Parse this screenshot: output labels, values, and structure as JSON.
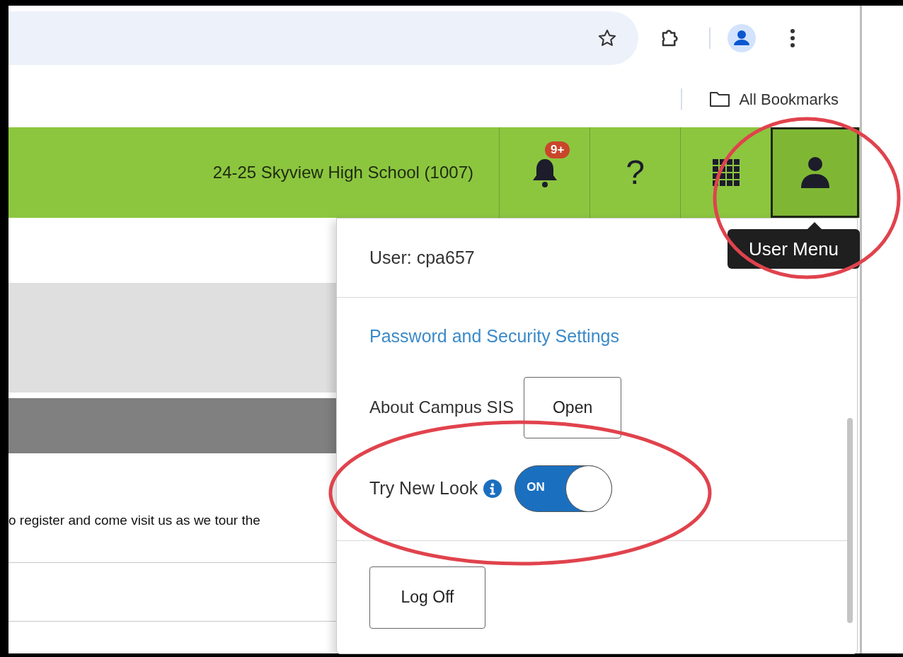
{
  "browser": {
    "bookmarks_bar": {
      "items": [
        {
          "label": "All Bookmarks"
        }
      ]
    }
  },
  "header": {
    "school": "24-25 Skyview High School (1007)",
    "buttons": [
      {
        "kind": "notifications",
        "badge": "9+",
        "selected": false
      },
      {
        "kind": "help",
        "label": "?",
        "selected": false
      },
      {
        "kind": "apps",
        "selected": false
      },
      {
        "kind": "user",
        "selected": true
      }
    ]
  },
  "tooltip": "User Menu",
  "page": {
    "notice_fragment": "o register and come visit us as we tour the"
  },
  "user_menu": {
    "user": "User: cpa657",
    "security_link": "Password and Security Settings",
    "about": {
      "label": "About Campus SIS",
      "button": "Open"
    },
    "new_look": {
      "label": "Try New Look",
      "on": true,
      "toggle_text": "ON"
    },
    "log_off": "Log Off"
  }
}
